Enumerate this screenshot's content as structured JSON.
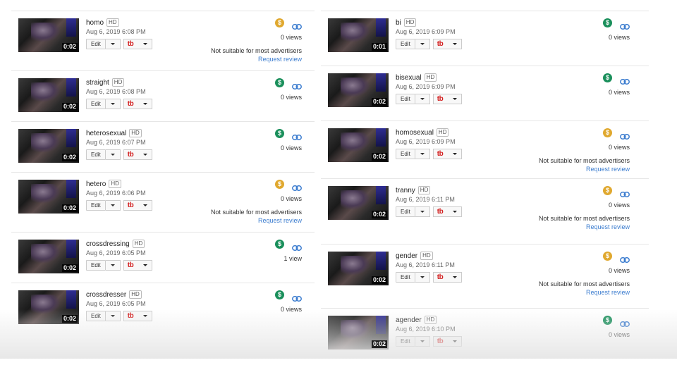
{
  "colors": {
    "monetized": "#1a8f5b",
    "limited": "#e0a82e",
    "link": "#3b7ccf",
    "tb_red": "#d32020"
  },
  "labels": {
    "edit": "Edit",
    "hd": "HD",
    "tb": "tb",
    "not_suitable": "Not suitable for most advertisers",
    "request_review": "Request review"
  },
  "left": [
    {
      "title": "homo",
      "date": "Aug 6, 2019 6:08 PM",
      "duration": "0:02",
      "views": "0 views",
      "monetization": "limited",
      "not_suitable": true
    },
    {
      "title": "straight",
      "date": "Aug 6, 2019 6:08 PM",
      "duration": "0:02",
      "views": "0 views",
      "monetization": "monetized",
      "not_suitable": false
    },
    {
      "title": "heterosexual",
      "date": "Aug 6, 2019 6:07 PM",
      "duration": "0:02",
      "views": "0 views",
      "monetization": "monetized",
      "not_suitable": false
    },
    {
      "title": "hetero",
      "date": "Aug 6, 2019 6:06 PM",
      "duration": "0:02",
      "views": "0 views",
      "monetization": "limited",
      "not_suitable": true
    },
    {
      "title": "crossdressing",
      "date": "Aug 6, 2019 6:05 PM",
      "duration": "0:02",
      "views": "1 view",
      "monetization": "monetized",
      "not_suitable": false
    },
    {
      "title": "crossdresser",
      "date": "Aug 6, 2019 6:05 PM",
      "duration": "0:02",
      "views": "0 views",
      "monetization": "monetized",
      "not_suitable": false
    }
  ],
  "right": [
    {
      "title": "bi",
      "date": "Aug 6, 2019 6:09 PM",
      "duration": "0:01",
      "views": "0 views",
      "monetization": "monetized",
      "not_suitable": false
    },
    {
      "title": "bisexual",
      "date": "Aug 6, 2019 6:09 PM",
      "duration": "0:02",
      "views": "0 views",
      "monetization": "monetized",
      "not_suitable": false
    },
    {
      "title": "homosexual",
      "date": "Aug 6, 2019 6:09 PM",
      "duration": "0:02",
      "views": "0 views",
      "monetization": "limited",
      "not_suitable": true
    },
    {
      "title": "tranny",
      "date": "Aug 6, 2019 6:11 PM",
      "duration": "0:02",
      "views": "0 views",
      "monetization": "limited",
      "not_suitable": true
    },
    {
      "title": "gender",
      "date": "Aug 6, 2019 6:11 PM",
      "duration": "0:02",
      "views": "0 views",
      "monetization": "limited",
      "not_suitable": true
    },
    {
      "title": "agender",
      "date": "Aug 6, 2019 6:10 PM",
      "duration": "0:02",
      "views": "0 views",
      "monetization": "monetized",
      "not_suitable": false
    }
  ]
}
